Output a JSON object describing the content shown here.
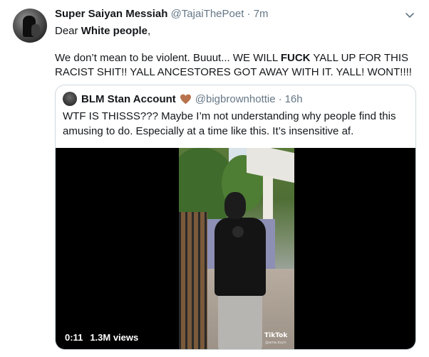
{
  "tweet": {
    "display_name": "Super Saiyan Messiah",
    "handle": "@TajaiThePoet",
    "separator": "·",
    "time": "7m",
    "greeting_prefix": "Dear",
    "greeting_bold": "White people",
    "greeting_suffix": ",",
    "text_part1": "We don’t mean to be violent. Buuut... WE WILL",
    "text_bold": "FUCK",
    "text_part2": "YALL UP FOR THIS RACIST SHIT!! YALL ANCESTORES GOT AWAY WITH IT. YALL! WONT!!!!",
    "menu_icon": "chevron-down-icon"
  },
  "quoted_tweet": {
    "display_name": "BLM Stan Account",
    "emoji_icon": "brown-heart-icon",
    "handle": "@bigbrownhottie",
    "separator": "·",
    "time": "16h",
    "text": "WTF IS THISSS??? Maybe I’m not understanding why people find this amusing to do. Especially at a time like this. It’s insensitive af.",
    "video": {
      "duration": "0:11",
      "views": "1.3M views",
      "watermark": "TikTok",
      "watermark_user": "@ama.kuyn"
    }
  },
  "colors": {
    "text_primary": "#14171a",
    "text_secondary": "#657786",
    "border": "#cfd9de",
    "heart": "#b8724e"
  }
}
